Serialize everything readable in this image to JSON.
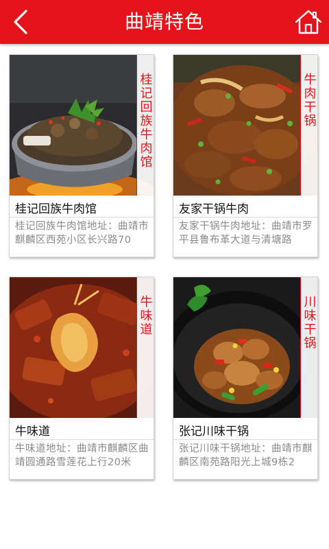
{
  "header": {
    "title": "曲靖特色",
    "back_icon": "chevron-left-icon",
    "home_icon": "home-icon",
    "bg_color": "#e5141c"
  },
  "restaurants": [
    {
      "name": "桂记回族牛肉馆",
      "tag": "桂记回族牛肉馆",
      "address": "桂记回族牛肉馆地址：曲靖市麒麟区西苑小区长兴路70"
    },
    {
      "name": "友家干锅牛肉",
      "tag": "牛肉干锅",
      "address": "友家干锅牛肉地址：曲靖市罗平县鲁布革大道与清塘路"
    },
    {
      "name": "牛味道",
      "tag": "牛味道",
      "address": "牛味道地址：曲靖市麒麟区曲靖圆通路雪莲花上行20米"
    },
    {
      "name": "张记川味干锅",
      "tag": "川味干锅",
      "address": "张记川味干锅地址：曲靖市麒麟区南苑路阳光上城9栋2"
    }
  ]
}
